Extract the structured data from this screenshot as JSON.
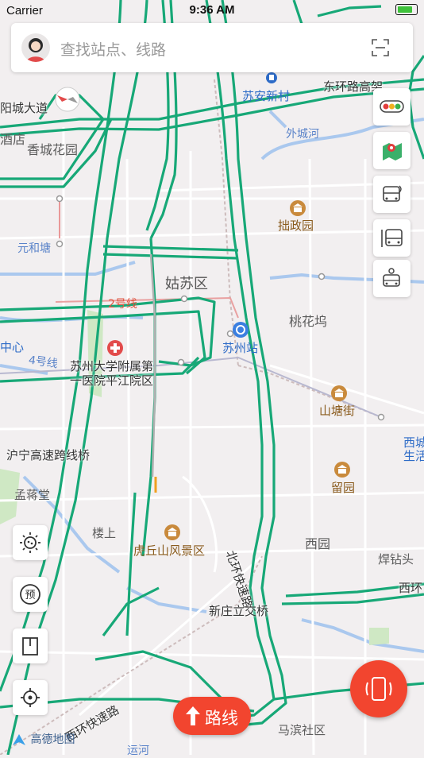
{
  "status_bar": {
    "carrier": "Carrier",
    "time": "9:36 AM"
  },
  "search": {
    "placeholder": "查找站点、线路"
  },
  "labels": {
    "jiebang": "东环路高架",
    "suan": "苏安新村",
    "huan_road": "阳城大道",
    "waicheng": "外城河",
    "hotel": "酒店",
    "xiangcheng": "香城花园",
    "zhuozheng": "拙政园",
    "yuanhe": "元和塘",
    "gusu": "姑苏区",
    "line2": "2号线",
    "taohuawu": "桃花坞",
    "zhongxin": "中心",
    "suzhou_station": "苏州站",
    "line4": "4号线",
    "hospital1": "苏州大学附属第",
    "hospital2": "一医院平江院区",
    "shantang": "山塘街",
    "xicheng": "西城",
    "shenghuo": "生活",
    "huning": "沪宁高速跨线桥",
    "liuyuan": "留园",
    "mengjiang": "孟蒋堂",
    "loushang": "楼上",
    "huqiu": "虎丘山风景区",
    "xiyuan": "西园",
    "hanzuantou": "焊钻头",
    "beihuan": "北环快速路",
    "xihuan": "西环",
    "xinzhuang": "新庄立交桥",
    "xihuan_express": "西环快速路",
    "mabin": "马滨社区",
    "yunhe": "运河",
    "trail_t": "道"
  },
  "route_button": {
    "label": "路线"
  },
  "logo": {
    "text": "高德地图"
  },
  "colors": {
    "expressway": "#17a877",
    "accent": "#f2452f",
    "water": "#aac8ee"
  },
  "icons": [
    "avatar-icon",
    "scan-icon",
    "traffic-light-icon",
    "map-layer-icon",
    "bus-realtime-icon",
    "bus-station-icon",
    "bus-route-icon",
    "sun-settings-icon",
    "reserve-icon",
    "bookmark-icon",
    "locate-icon",
    "shake-phone-icon",
    "route-arrow-icon"
  ]
}
